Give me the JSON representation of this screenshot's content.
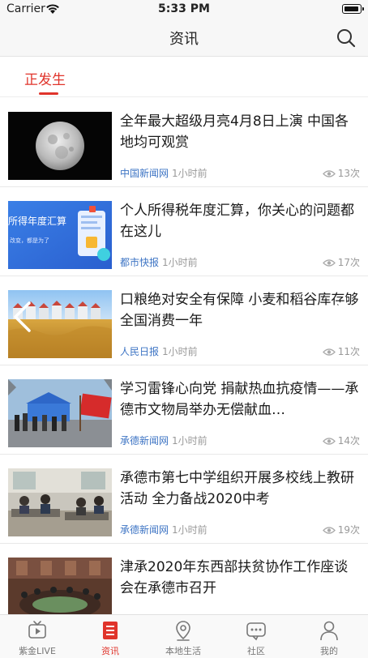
{
  "status_bar": {
    "carrier": "Carrier",
    "time": "5:33 PM"
  },
  "nav": {
    "title": "资讯",
    "search_icon": "search-icon"
  },
  "tabs": [
    {
      "label": "正发生",
      "active": true
    }
  ],
  "news": [
    {
      "title": "全年最大超级月亮4月8日上演 中国各地均可观赏",
      "source": "中国新闻网",
      "time": "1小时前",
      "views": "13次",
      "image": "full-moon"
    },
    {
      "title": "个人所得税年度汇算，你关心的问题都在这儿",
      "source": "都市快报",
      "time": "1小时前",
      "views": "17次",
      "image": "tax-banner",
      "image_text": "所得年度汇算",
      "image_subtext": "改变，都是为了"
    },
    {
      "title": "口粮绝对安全有保障 小麦和稻谷库存够全国消费一年",
      "source": "人民日报",
      "time": "1小时前",
      "views": "11次",
      "image": "wheat-field-silos"
    },
    {
      "title": "学习雷锋心向党 捐献热血抗疫情——承德市文物局举办无偿献血…",
      "source": "承德新闻网",
      "time": "1小时前",
      "views": "14次",
      "image": "blood-donation-tent"
    },
    {
      "title": "承德市第七中学组织开展多校线上教研活动 全力备战2020中考",
      "source": "承德新闻网",
      "time": "1小时前",
      "views": "19次",
      "image": "classroom-meeting"
    },
    {
      "title": "津承2020年东西部扶贫协作工作座谈会在承德市召开",
      "source": "",
      "time": "",
      "views": "",
      "image": "conference-room"
    }
  ],
  "tab_bar": [
    {
      "label": "紫金LIVE",
      "icon": "tv-icon",
      "active": false
    },
    {
      "label": "资讯",
      "icon": "news-list-icon",
      "active": true
    },
    {
      "label": "本地生活",
      "icon": "location-pin-icon",
      "active": false
    },
    {
      "label": "社区",
      "icon": "chat-bubble-icon",
      "active": false
    },
    {
      "label": "我的",
      "icon": "person-icon",
      "active": false
    }
  ],
  "colors": {
    "accent": "#e0342b",
    "source_text": "#3d74c4",
    "muted": "#999999"
  }
}
